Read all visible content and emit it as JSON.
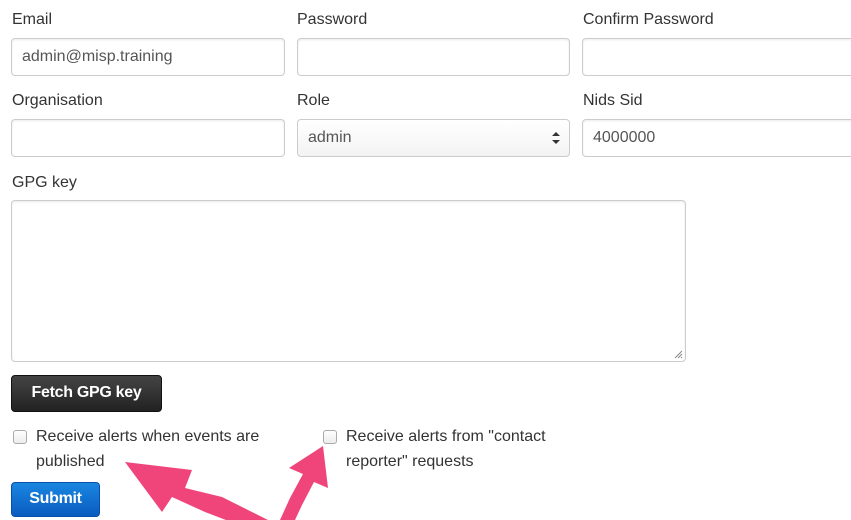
{
  "form": {
    "email": {
      "label": "Email",
      "value": "admin@misp.training"
    },
    "password": {
      "label": "Password",
      "value": ""
    },
    "confirm_password": {
      "label": "Confirm Password",
      "value": ""
    },
    "organisation": {
      "label": "Organisation",
      "value": ""
    },
    "role": {
      "label": "Role",
      "value": "admin"
    },
    "nids_sid": {
      "label": "Nids Sid",
      "value": "4000000"
    },
    "gpg_key": {
      "label": "GPG key",
      "value": ""
    },
    "fetch_gpg_label": "Fetch GPG key",
    "alert_events": {
      "label_line1": "Receive alerts when events are",
      "label_line2": "published",
      "checked": false
    },
    "alert_contact": {
      "label_line1": "Receive alerts from \"contact",
      "label_line2": "reporter\" requests",
      "checked": false
    },
    "submit_label": "Submit"
  },
  "colors": {
    "annotation_arrow": "#f0457a",
    "primary_button": "#0e6fd6",
    "dark_button": "#2a2a2a"
  },
  "icons": {
    "select_arrow": "updown-chevron-icon",
    "resize": "resize-grip-icon",
    "annotation": "arrow-annotation-icon"
  }
}
